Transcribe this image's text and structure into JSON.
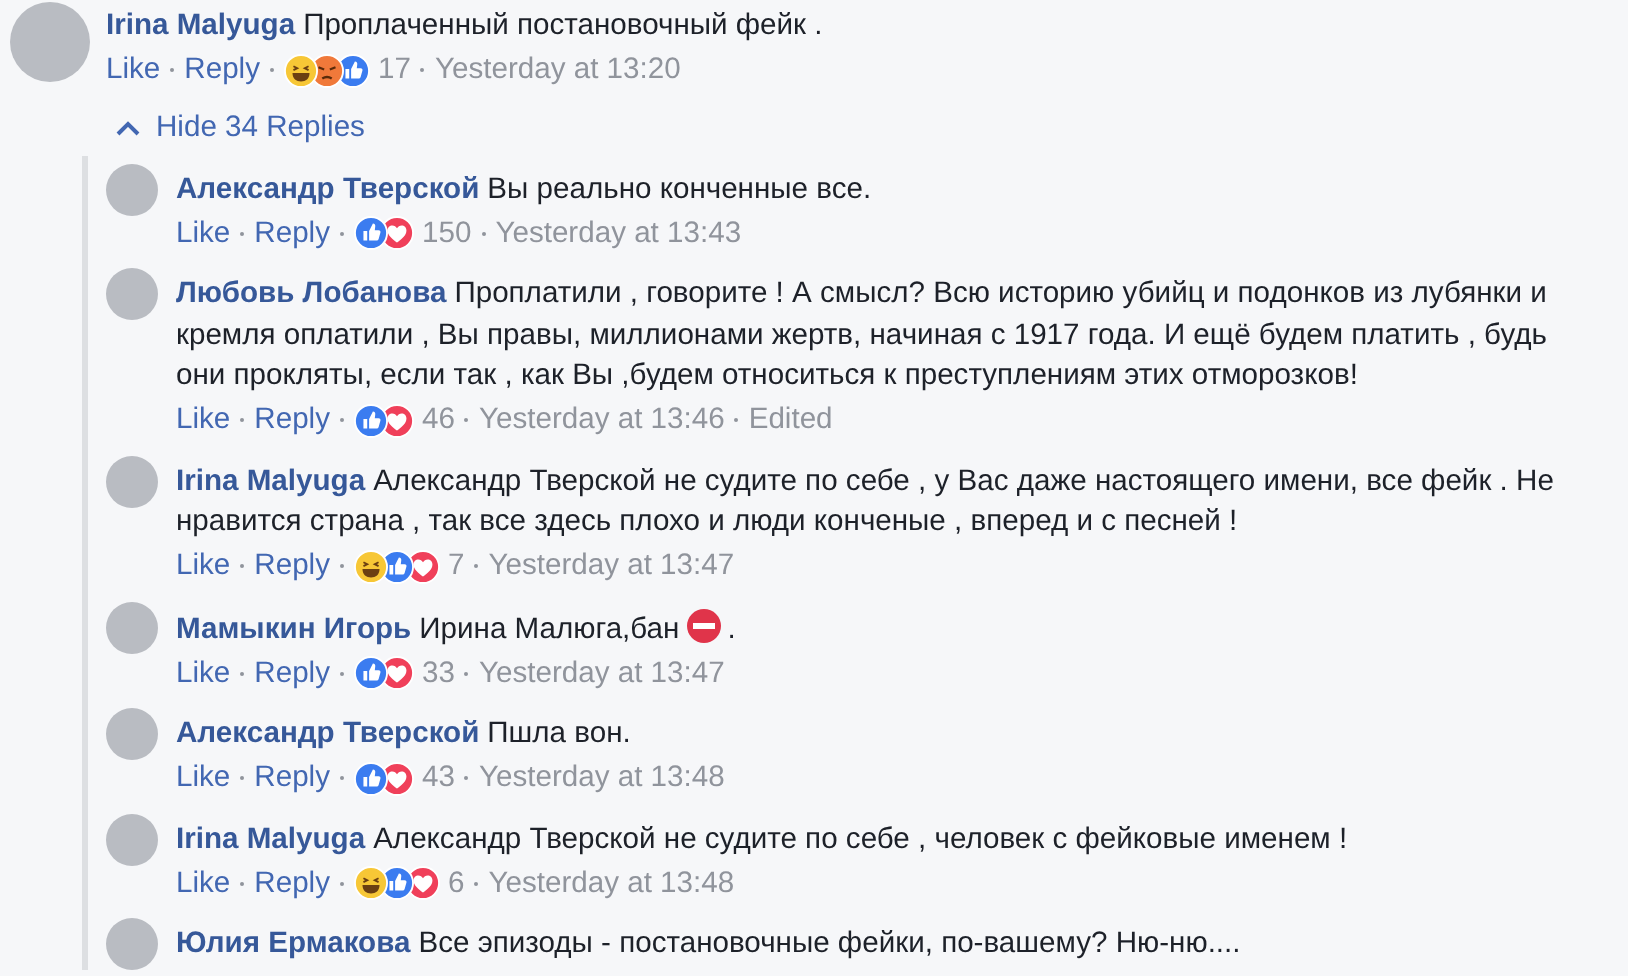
{
  "comment": {
    "author": "Irina Malyuga",
    "text": "Проплаченный постановочный фейк .",
    "like": "Like",
    "reply": "Reply",
    "reactions": [
      {
        "kind": "haha"
      },
      {
        "kind": "angry"
      },
      {
        "kind": "like"
      }
    ],
    "count": "17",
    "time": "Yesterday at 13:20"
  },
  "toggle": {
    "label": "Hide 34 Replies",
    "expanded": true
  },
  "replies": [
    {
      "author": "Александр Тверской",
      "text": "Вы реально конченные все.",
      "like": "Like",
      "reply": "Reply",
      "reactions": [
        {
          "kind": "like"
        },
        {
          "kind": "love"
        }
      ],
      "count": "150",
      "time": "Yesterday at 13:43"
    },
    {
      "author": "Любовь Лобанова",
      "text": "Проплатили , говорите ! А смысл? Всю историю убийц и подонков из лубянки и кремля оплатили , Вы правы, миллионами жертв, начиная с 1917 года. И ещё будем платить , будь они прокляты, если так , как Вы ,будем относиться к преступлениям этих отморозков!",
      "like": "Like",
      "reply": "Reply",
      "reactions": [
        {
          "kind": "like"
        },
        {
          "kind": "love"
        }
      ],
      "count": "46",
      "time": "Yesterday at 13:46",
      "edited": "Edited"
    },
    {
      "author": "Irina Malyuga",
      "text": "Александр Тверской не судите по себе , у Вас даже настоящего имени, все фейк . Не нравится страна , так все здесь плохо и люди конченые , вперед и с песней !",
      "like": "Like",
      "reply": "Reply",
      "reactions": [
        {
          "kind": "haha"
        },
        {
          "kind": "like"
        },
        {
          "kind": "love"
        }
      ],
      "count": "7",
      "time": "Yesterday at 13:47"
    },
    {
      "author": "Мамыкин Игорь",
      "text": "Ирина Малюга,бан",
      "emoji": {
        "kind": "no_entry"
      },
      "text_end": ".",
      "like": "Like",
      "reply": "Reply",
      "reactions": [
        {
          "kind": "like"
        },
        {
          "kind": "love"
        }
      ],
      "count": "33",
      "time": "Yesterday at 13:47"
    },
    {
      "author": "Александр Тверской",
      "text": "Пшла вон.",
      "like": "Like",
      "reply": "Reply",
      "reactions": [
        {
          "kind": "like"
        },
        {
          "kind": "love"
        }
      ],
      "count": "43",
      "time": "Yesterday at 13:48"
    },
    {
      "author": "Irina Malyuga",
      "text": "Александр Тверской не судите по себе , человек с фейковые именем !",
      "like": "Like",
      "reply": "Reply",
      "reactions": [
        {
          "kind": "haha"
        },
        {
          "kind": "like"
        },
        {
          "kind": "love"
        }
      ],
      "count": "6",
      "time": "Yesterday at 13:48"
    },
    {
      "author": "Юлия Ермакова",
      "text": "Все эпизоды - постановочные фейки, по-вашему? Ню-ню...."
    }
  ]
}
